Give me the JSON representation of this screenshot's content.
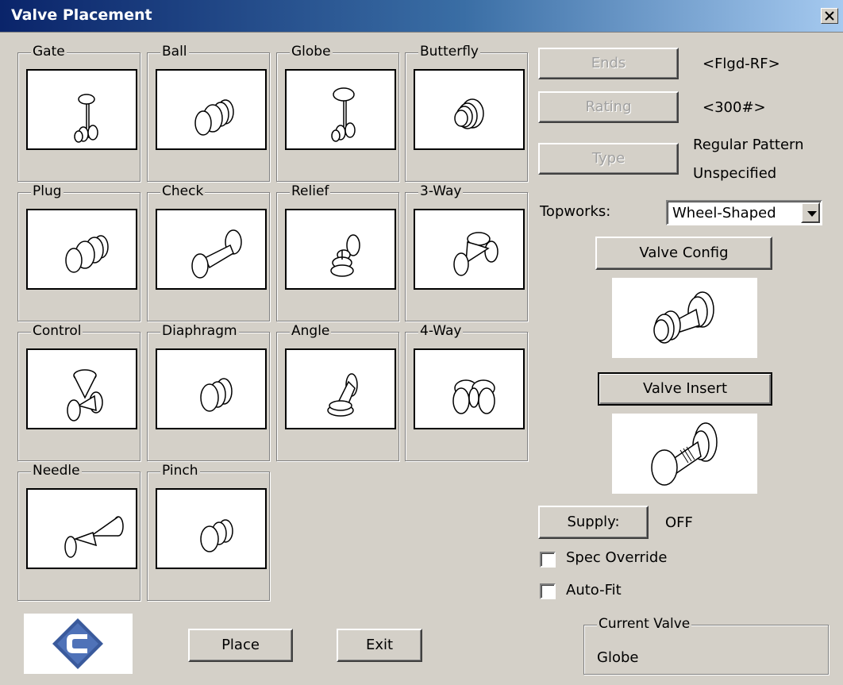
{
  "window": {
    "title": "Valve Placement"
  },
  "valves": [
    {
      "label": "Gate"
    },
    {
      "label": "Ball"
    },
    {
      "label": "Globe"
    },
    {
      "label": "Butterfly"
    },
    {
      "label": "Plug"
    },
    {
      "label": "Check"
    },
    {
      "label": "Relief"
    },
    {
      "label": "3-Way"
    },
    {
      "label": "Control"
    },
    {
      "label": "Diaphragm"
    },
    {
      "label": "Angle"
    },
    {
      "label": "4-Way"
    },
    {
      "label": "Needle"
    },
    {
      "label": "Pinch"
    }
  ],
  "specs": {
    "ends_button": "Ends",
    "ends_value": "<Flgd-RF>",
    "rating_button": "Rating",
    "rating_value": "<300#>",
    "type_button": "Type",
    "type_line1": "Regular Pattern",
    "type_line2": "Unspecified"
  },
  "topworks": {
    "label": "Topworks:",
    "selected": "Wheel-Shaped"
  },
  "buttons": {
    "valve_config": "Valve Config",
    "valve_insert": "Valve Insert",
    "supply": "Supply:",
    "place": "Place",
    "exit": "Exit"
  },
  "supply": {
    "value": "OFF"
  },
  "options": {
    "spec_override": {
      "label": "Spec Override",
      "checked": false
    },
    "auto_fit": {
      "label": "Auto-Fit",
      "checked": false
    }
  },
  "current_valve": {
    "legend": "Current Valve",
    "value": "Globe"
  },
  "colors": {
    "title_start": "#0a246a",
    "title_end": "#a6caf0",
    "face": "#d4d0c8",
    "logo_blue": "#3a5a9c"
  }
}
